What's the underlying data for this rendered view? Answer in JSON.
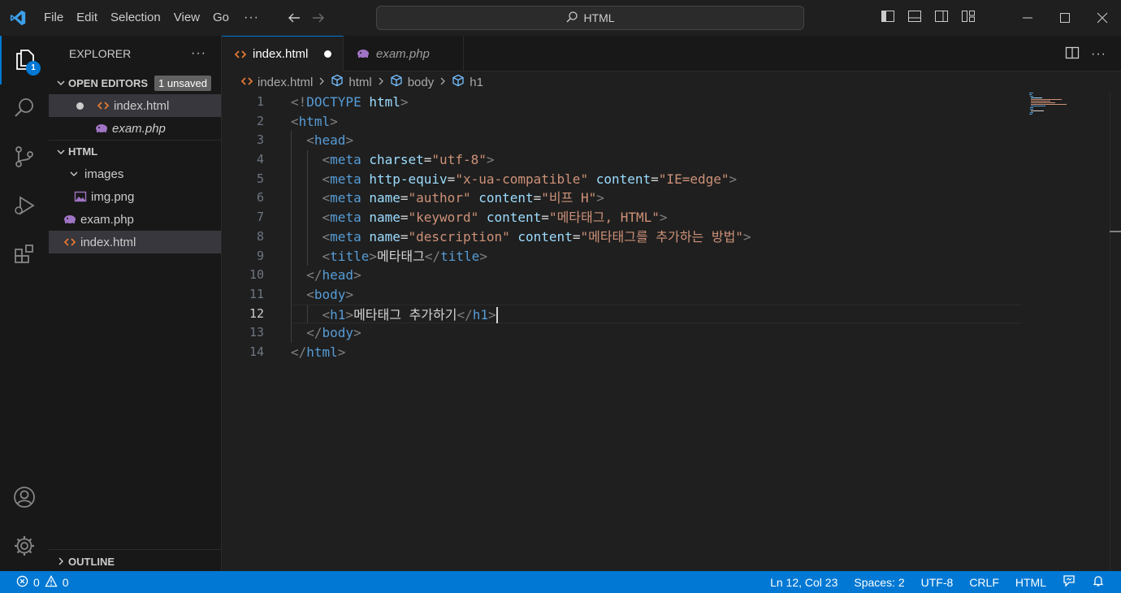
{
  "titlebar": {
    "menu": [
      "File",
      "Edit",
      "Selection",
      "View",
      "Go"
    ],
    "more": "···",
    "search_text": "HTML"
  },
  "activitybar": {
    "explorer_badge": "1"
  },
  "sidebar": {
    "title": "EXPLORER",
    "more": "···",
    "open_editors": {
      "title": "OPEN EDITORS",
      "badge": "1 unsaved",
      "items": [
        {
          "label": "index.html",
          "italic": false,
          "dirty": true
        },
        {
          "label": "exam.php",
          "italic": true,
          "dirty": false
        }
      ]
    },
    "folder": {
      "title": "HTML",
      "items": [
        {
          "label": "images",
          "type": "folder"
        },
        {
          "label": "img.png",
          "type": "image"
        },
        {
          "label": "exam.php",
          "type": "php"
        },
        {
          "label": "index.html",
          "type": "html"
        }
      ]
    },
    "outline_title": "OUTLINE"
  },
  "tabs": [
    {
      "label": "index.html",
      "active": true,
      "dirty": true
    },
    {
      "label": "exam.php",
      "active": false,
      "italic": true
    }
  ],
  "breadcrumbs": [
    "index.html",
    "html",
    "body",
    "h1"
  ],
  "editor": {
    "line_numbers": [
      "1",
      "2",
      "3",
      "4",
      "5",
      "6",
      "7",
      "8",
      "9",
      "10",
      "11",
      "12",
      "13",
      "14"
    ],
    "current_line": 12
  },
  "statusbar": {
    "errors": "0",
    "warnings": "0",
    "position": "Ln 12, Col 23",
    "spaces": "Spaces: 2",
    "encoding": "UTF-8",
    "eol": "CRLF",
    "language": "HTML"
  },
  "colors": {
    "accent": "#0078d4",
    "html_icon": "#e37933",
    "php_icon": "#a074c4"
  }
}
